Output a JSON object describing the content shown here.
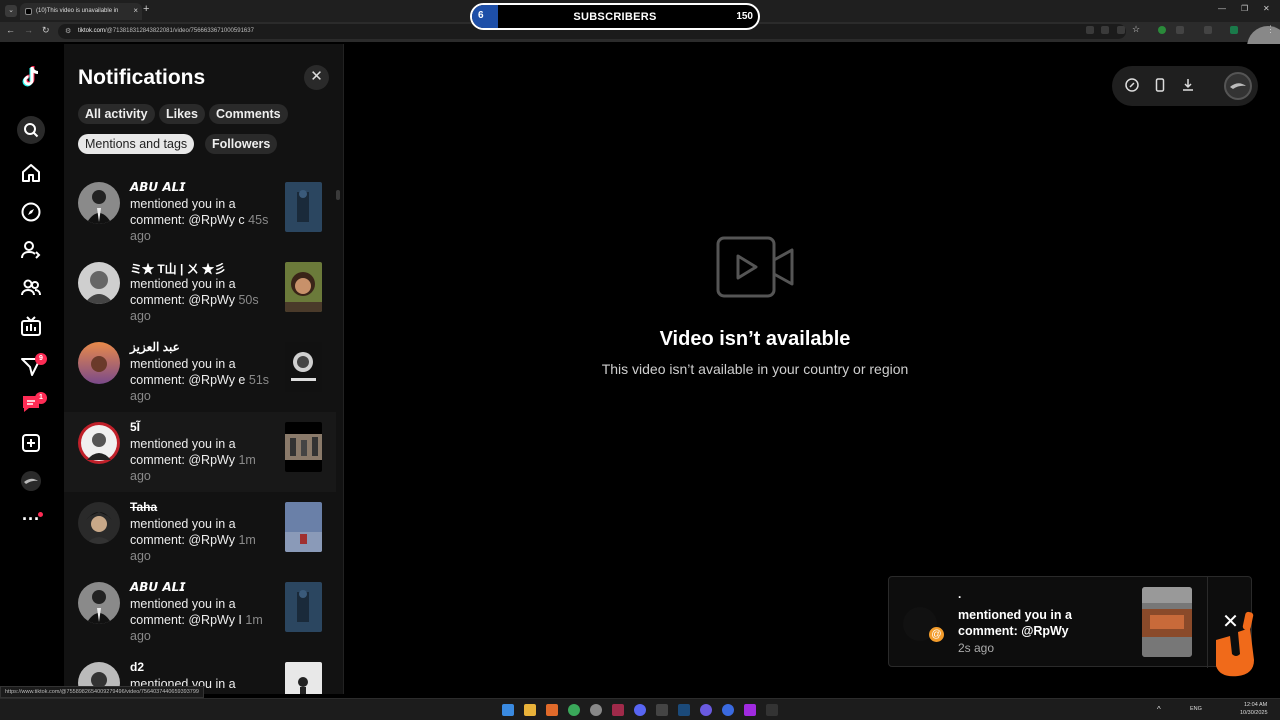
{
  "browser": {
    "tab_title": "(10)This video is unavailable in",
    "url_domain": "tiktok.com",
    "url_path": "/@7138183128438220​81/video/7566633671000591637",
    "status_url": "https://www.tiktok.com/@7558982654009279496/video/7564037440659393799"
  },
  "subscribers": {
    "level": "6",
    "label": "SUBSCRIBERS",
    "count": "150",
    "accent": "#1e4fa8"
  },
  "rail": {
    "logo_icon": "tiktok-logo-icon",
    "inbox_badge": "9",
    "messages_badge": "1"
  },
  "notifications": {
    "title": "Notifications",
    "filters": [
      "All activity",
      "Likes",
      "Comments",
      "Mentions and tags",
      "Followers"
    ],
    "active_filter": "Mentions and tags",
    "items": [
      {
        "name": "𝘼𝘽𝙐 𝘼𝙇𝙄",
        "text": "mentioned you in a comment: @RpWy c",
        "time": "45s ago"
      },
      {
        "name": "ミ★ T山 | ㄨ ★彡",
        "text": "mentioned you in a comment: @RpWy",
        "time": "50s ago"
      },
      {
        "name": "عبد العزيز",
        "text": "mentioned you in a comment: @RpWy e",
        "time": "51s ago"
      },
      {
        "name": "5Ĩ",
        "text": "mentioned you in a comment: @RpWy",
        "time": "1m ago"
      },
      {
        "name": "Taha",
        "text": "mentioned you in a comment: @RpWy",
        "time": "1m ago"
      },
      {
        "name": "𝘼𝘽𝙐 𝘼𝙇𝙄",
        "text": "mentioned you in a comment: @RpWy I",
        "time": "1m ago"
      },
      {
        "name": "d2",
        "text": "mentioned you in a",
        "time": ""
      }
    ]
  },
  "main": {
    "title": "Video isn’t available",
    "subtitle": "This video isn’t available in your country or region"
  },
  "toast": {
    "name": ".",
    "text": "mentioned you in a comment: @RpWy",
    "time": "2s ago",
    "accent": "#f39c2b"
  },
  "taskbar": {
    "lang": "ENG",
    "time": "12:04 AM",
    "date": "10/30/2025"
  }
}
